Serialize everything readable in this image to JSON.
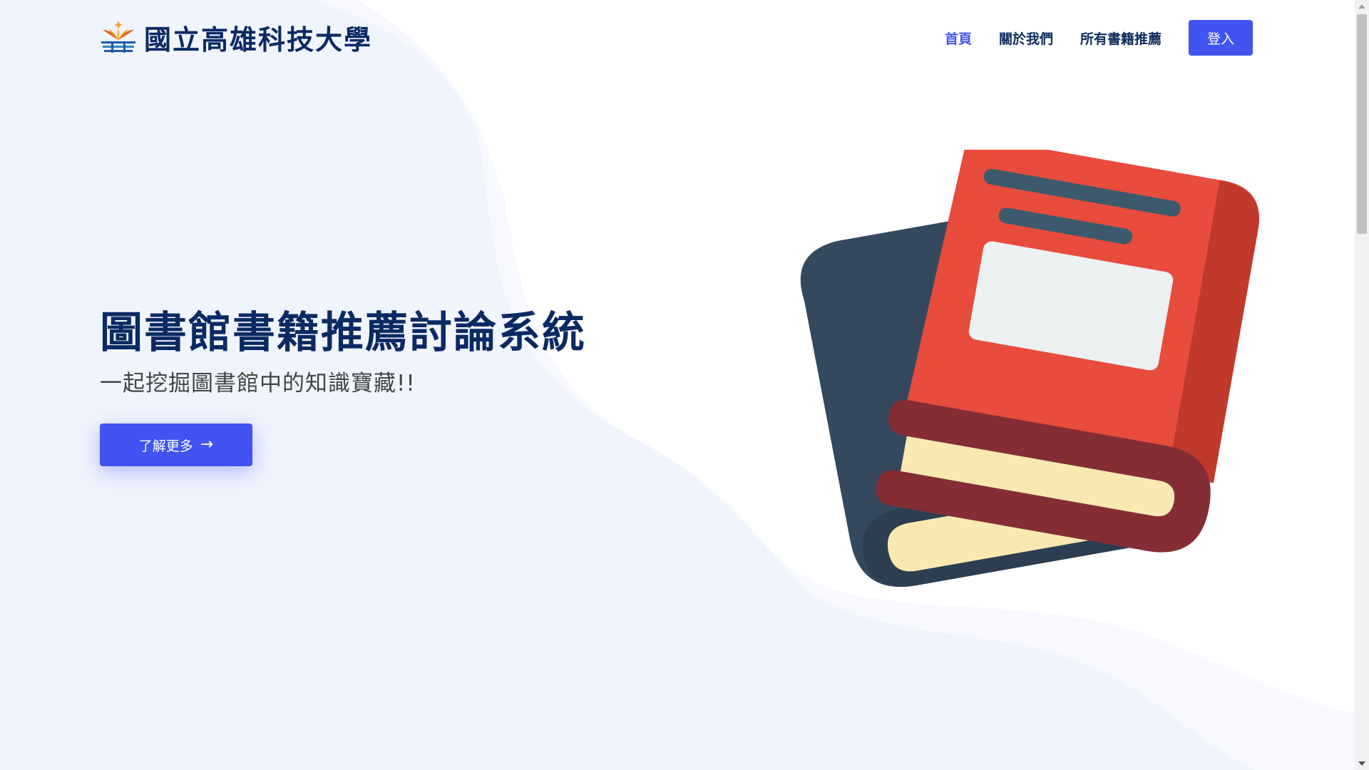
{
  "header": {
    "logo_text": "國立高雄科技大學",
    "nav": {
      "home": "首頁",
      "about": "關於我們",
      "all_books": "所有書籍推薦"
    },
    "login_label": "登入"
  },
  "hero": {
    "title": "圖書館書籍推薦討論系統",
    "subtitle": "一起挖掘圖書館中的知識寶藏!!",
    "cta_label": "了解更多"
  },
  "colors": {
    "accent": "#4154f1",
    "heading": "#0b2a63",
    "background_wave": "#f0f4fd"
  },
  "icons": {
    "logo": "university-logo-icon",
    "cta_arrow": "arrow-right-icon",
    "illustration": "books-illustration-icon"
  }
}
